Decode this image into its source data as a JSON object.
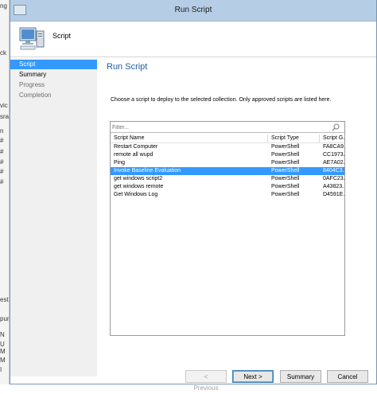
{
  "window": {
    "title": "Run Script"
  },
  "header": {
    "title": "Script"
  },
  "nav": {
    "items": [
      {
        "label": "Script",
        "state": "active"
      },
      {
        "label": "Summary",
        "state": "normal"
      },
      {
        "label": "Progress",
        "state": "inactive"
      },
      {
        "label": "Completion",
        "state": "inactive"
      }
    ]
  },
  "main": {
    "title": "Run Script",
    "description": "Choose a script to deploy to the selected collection. Only approved scripts are listed here."
  },
  "list": {
    "filter_placeholder": "Filter...",
    "columns": [
      "Script Name",
      "Script Type",
      "Script G..."
    ],
    "rows": [
      [
        "Restart Computer",
        "PowerShell",
        "FA8CA9..."
      ],
      [
        "remote all wupd",
        "PowerShell",
        "CC1973..."
      ],
      [
        "Ping",
        "PowerShell",
        "AE7A02..."
      ],
      [
        "Invoke Baseline Evaluation",
        "PowerShell",
        "8404C3..."
      ],
      [
        "get windows script2",
        "PowerShell",
        "0AFC23..."
      ],
      [
        "get windows remote",
        "PowerShell",
        "A43823..."
      ],
      [
        "Get Windows Log",
        "PowerShell",
        "D4591E..."
      ]
    ],
    "selected_index": 3
  },
  "buttons": {
    "previous": "< Previous",
    "next": "Next >",
    "summary": "Summary",
    "cancel": "Cancel"
  },
  "background_app": {
    "fragments": [
      "ng",
      "ck",
      "vic",
      "sra",
      "n",
      "#",
      "#",
      "#",
      "#",
      "#",
      "est",
      "pun",
      "N",
      "U",
      "M",
      "M",
      "I"
    ]
  }
}
